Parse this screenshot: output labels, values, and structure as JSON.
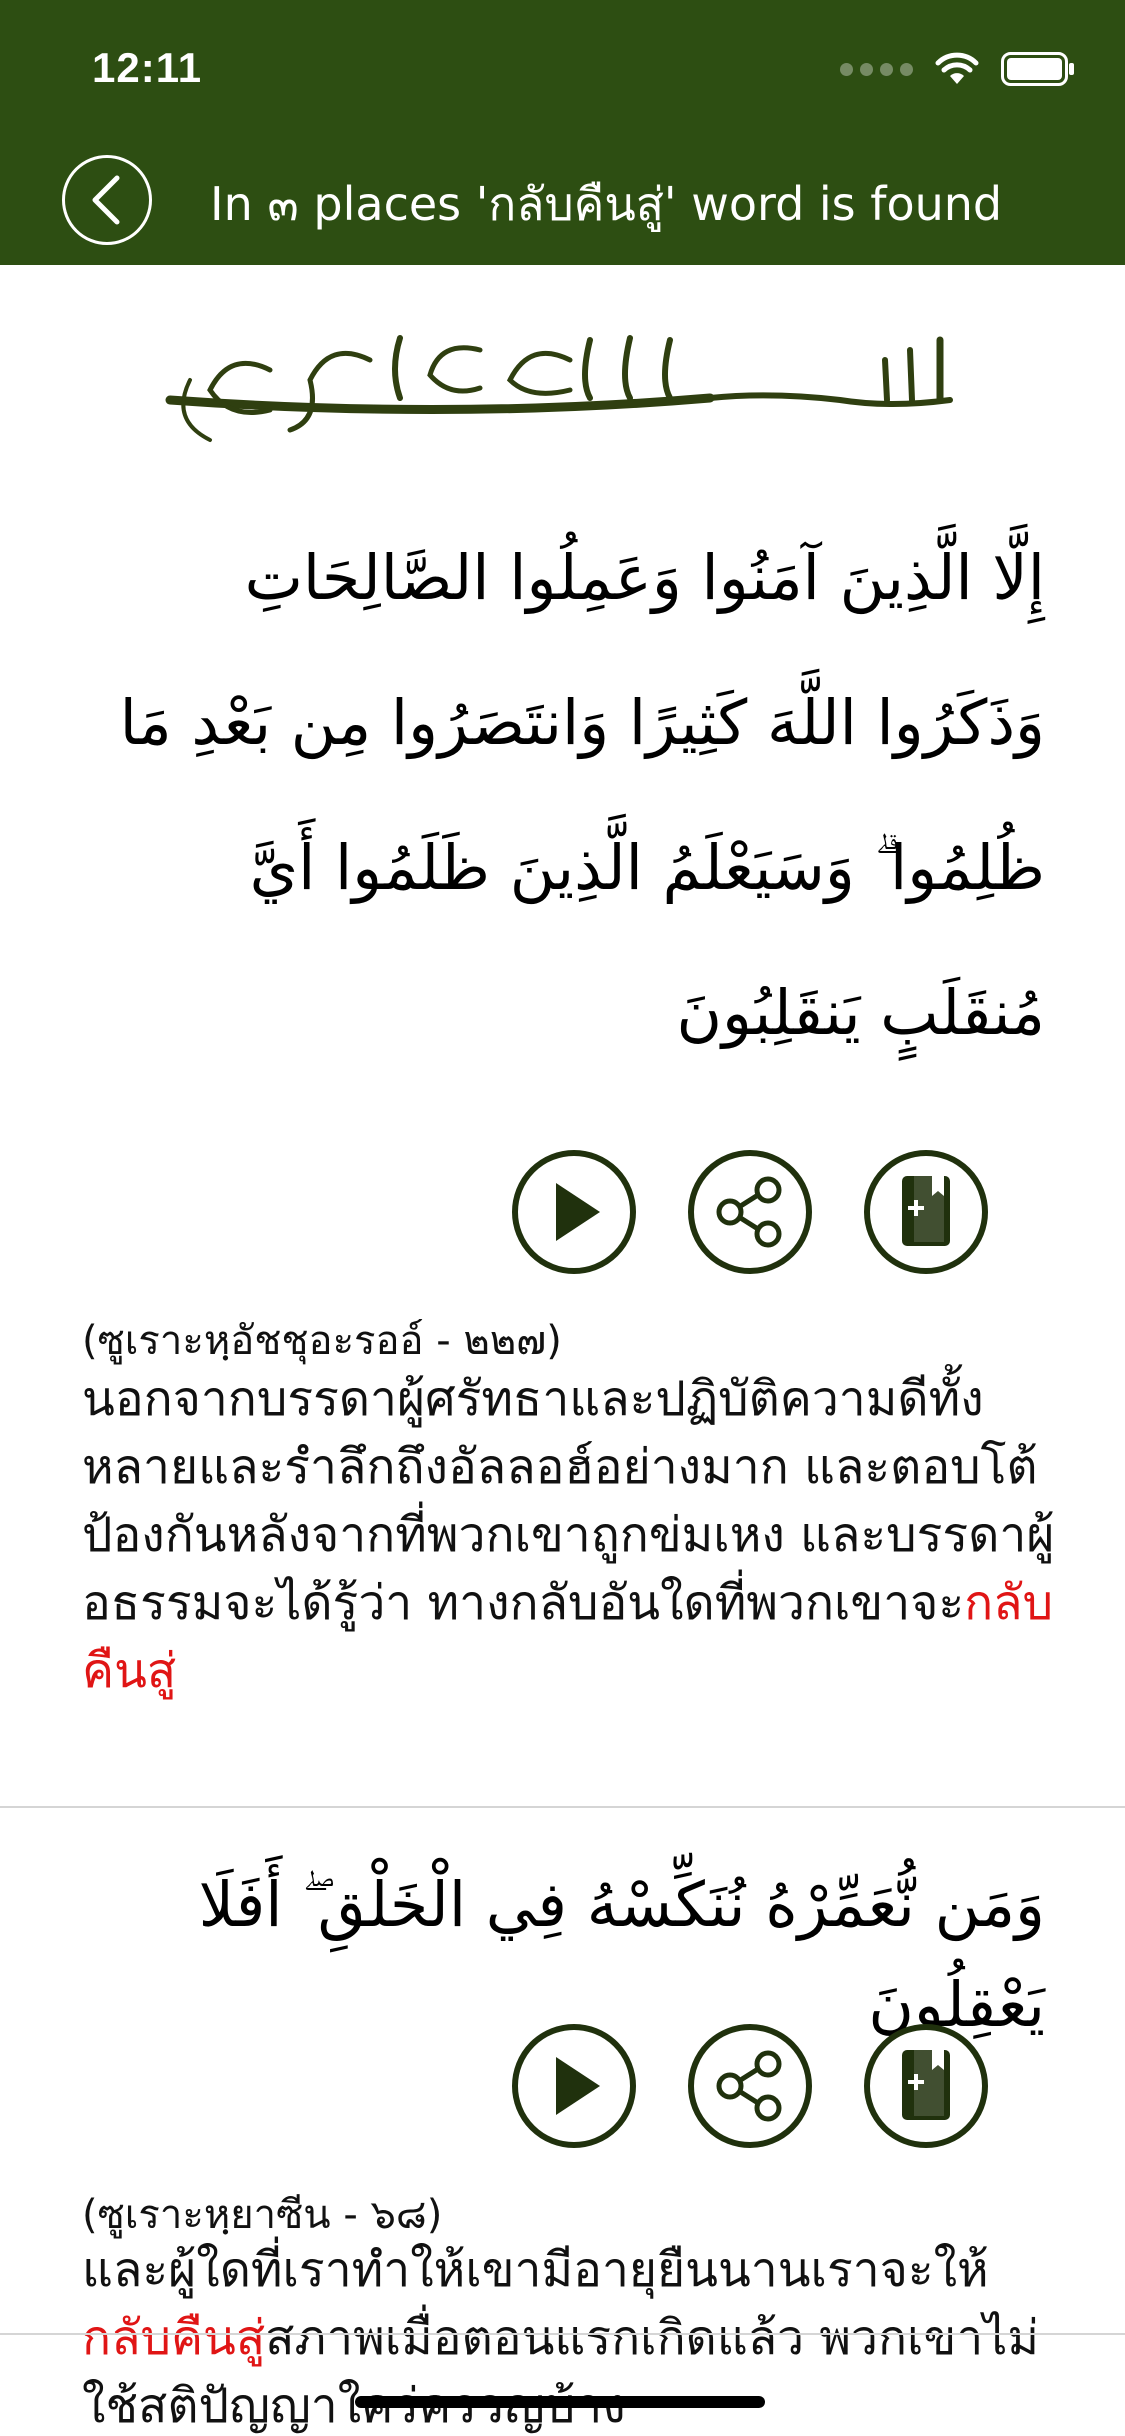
{
  "status_bar": {
    "time": "12:11"
  },
  "header": {
    "title": "In ๓ places 'กลับคืนสู่' word is found"
  },
  "results": [
    {
      "arabic": "إِلَّا الَّذِينَ آمَنُوا وَعَمِلُوا الصَّالِحَاتِ وَذَكَرُوا اللَّهَ كَثِيرًا وَانتَصَرُوا مِن بَعْدِ مَا ظُلِمُوا ۗ وَسَيَعْلَمُ الَّذِينَ ظَلَمُوا أَيَّ مُنقَلَبٍ يَنقَلِبُونَ",
      "reference": "(ซูเราะหฺอัชชุอะรออ์ - ๒๒๗)",
      "translation_before": "นอกจากบรรดาผู้ศรัทธาและปฏิบัติความดีทั้งหลายและรำลึกถึงอัลลอฮ์อย่างมาก และตอบโต้ป้องกันหลังจากที่พวกเขาถูกข่มเหง และบรรดาผู้อธรรมจะได้รู้ว่า ทางกลับอันใดที่พวกเขาจะ",
      "translation_highlight": "กลับคืนสู่",
      "translation_after": ""
    },
    {
      "arabic": "وَمَن نُّعَمِّرْهُ نُنَكِّسْهُ فِي الْخَلْقِ ۖ أَفَلَا يَعْقِلُونَ",
      "reference": "(ซูเราะหฺยาซีน - ๖๘)",
      "translation_before": "และผู้ใดที่เราทำให้เขามีอายุยืนนานเราจะให้",
      "translation_highlight": "กลับคืนสู่",
      "translation_after": "สภาพเมื่อตอนแรกเกิดแล้ว พวกเขาไม่ใช้สติปัญญาใคร่ครวญบ้าง"
    }
  ]
}
